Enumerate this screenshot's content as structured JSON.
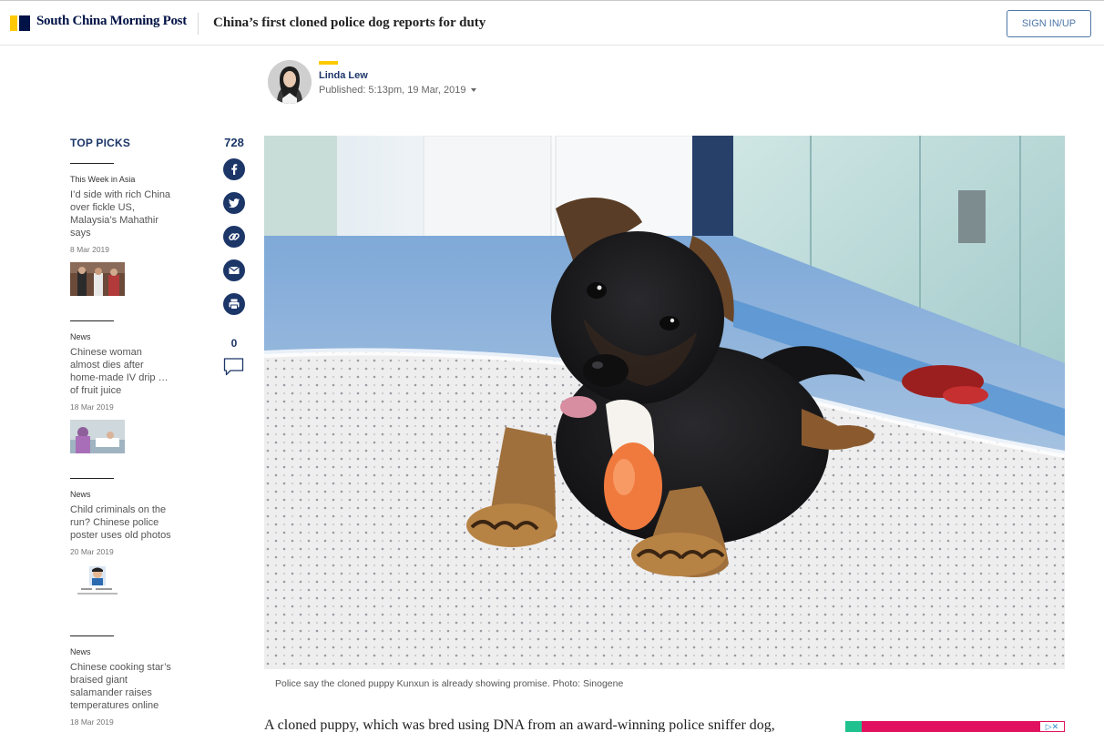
{
  "header": {
    "brand": "South China Morning Post",
    "article_title": "China’s first cloned police dog reports for duty",
    "signin_label": "SIGN IN/UP"
  },
  "author": {
    "name": "Linda Lew",
    "published": "Published: 5:13pm, 19 Mar, 2019"
  },
  "top_picks": {
    "heading": "TOP PICKS",
    "items": [
      {
        "section": "This Week in Asia",
        "title": "I’d side with rich China over fickle US, Malaysia’s Mahathir says",
        "date": "8 Mar 2019"
      },
      {
        "section": "News",
        "title": "Chinese woman almost dies after home-made IV drip … of fruit juice",
        "date": "18 Mar 2019"
      },
      {
        "section": "News",
        "title": "Child criminals on the run? Chinese police poster uses old photos",
        "date": "20 Mar 2019"
      },
      {
        "section": "News",
        "title": "Chinese cooking star’s braised giant salamander raises temperatures online",
        "date": "18 Mar 2019"
      }
    ]
  },
  "share": {
    "count": "728",
    "buttons": [
      "facebook-icon",
      "twitter-icon",
      "link-icon",
      "email-icon",
      "print-icon"
    ],
    "comment_count": "0"
  },
  "hero": {
    "caption": "Police say the cloned puppy Kunxun is already showing promise. Photo: Sinogene"
  },
  "article": {
    "lead": "A cloned puppy, which was bred using DNA from an award-winning police sniffer dog,"
  },
  "colors": {
    "brand_navy": "#001246",
    "brand_yellow": "#ffca05",
    "link_blue": "#1c3668",
    "signin_blue": "#4e77a8"
  }
}
